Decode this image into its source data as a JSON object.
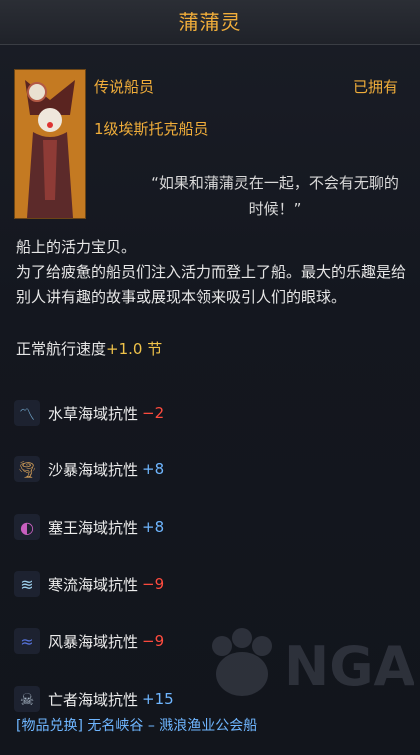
{
  "title": "蒲蒲灵",
  "grade": "传说船员",
  "owned": "已拥有",
  "rank": "1级埃斯托克船员",
  "quote": "“如果和蒲蒲灵在一起，不会有无聊的时候！”",
  "description": [
    "船上的活力宝贝。",
    "为了给疲惫的船员们注入活力而登上了船。最大的乐趣是给别人讲有趣的故事或展现本领来吸引人们的眼球。"
  ],
  "speed": {
    "label": "正常航行速度",
    "value": "+1.0 节"
  },
  "resistances": [
    {
      "label": "水草海域抗性",
      "value": "−2",
      "sign": "neg",
      "icon": "seaweed-icon",
      "color": "#6fa3c8"
    },
    {
      "label": "沙暴海域抗性",
      "value": "+8",
      "sign": "pos",
      "icon": "sandstorm-icon",
      "color": "#d9a35a"
    },
    {
      "label": "塞王海域抗性",
      "value": "+8",
      "sign": "pos",
      "icon": "siren-icon",
      "color": "#c75fbf"
    },
    {
      "label": "寒流海域抗性",
      "value": "−9",
      "sign": "neg",
      "icon": "coldcurrent-icon",
      "color": "#9fd2ef"
    },
    {
      "label": "风暴海域抗性",
      "value": "−9",
      "sign": "neg",
      "icon": "storm-icon",
      "color": "#5570d6"
    },
    {
      "label": "亡者海域抗性",
      "value": "+15",
      "sign": "pos",
      "icon": "dead-sea-icon",
      "color": "#a9b7c6"
    }
  ],
  "footer": "[物品兑换] 无名峡谷 – 溅浪渔业公会船",
  "watermark": "NGA"
}
